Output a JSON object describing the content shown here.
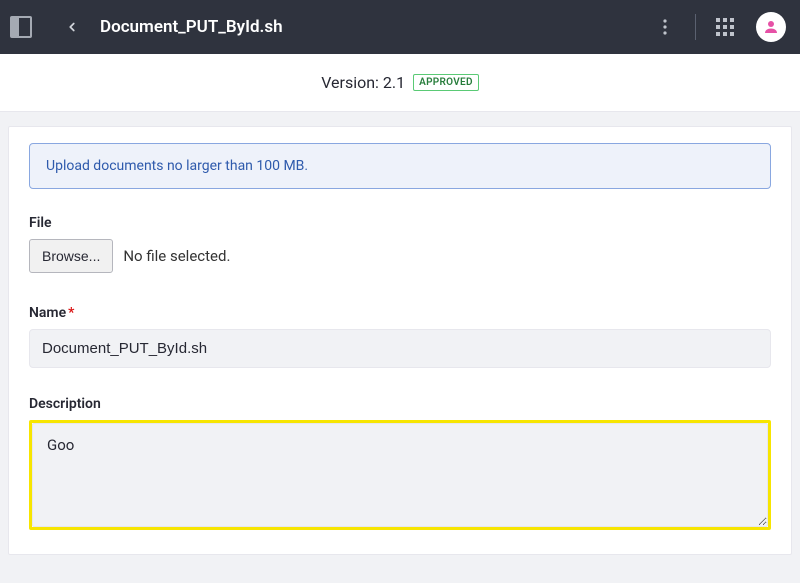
{
  "header": {
    "title": "Document_PUT_ById.sh"
  },
  "version": {
    "label": "Version: 2.1",
    "badge": "APPROVED"
  },
  "alert": {
    "text": "Upload documents no larger than 100 MB."
  },
  "form": {
    "file_label": "File",
    "browse_label": "Browse...",
    "file_status": "No file selected.",
    "name_label": "Name",
    "name_value": "Document_PUT_ById.sh",
    "description_label": "Description",
    "description_value": "Goo"
  }
}
